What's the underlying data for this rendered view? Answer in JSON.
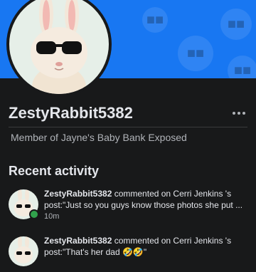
{
  "profile": {
    "username": "ZestyRabbit5382",
    "member_prefix": "Member of",
    "group_name": "Jayne's Baby Bank Exposed"
  },
  "recent_activity": {
    "title": "Recent activity",
    "items": [
      {
        "user": "ZestyRabbit5382",
        "action": "commented on Cerri Jenkins 's",
        "post_text": "post:\"Just so you guys know those photos she put ...",
        "time": "10m"
      },
      {
        "user": "ZestyRabbit5382",
        "action": "commented on Cerri Jenkins 's",
        "post_text": "post:\"That's her dad 🤣🤣\"",
        "time": ""
      }
    ]
  },
  "colors": {
    "cover": "#1877f2",
    "background": "#18191a",
    "online": "#31a24c"
  },
  "icons": {
    "more": "more-horizontal-icon",
    "online": "online-status-icon"
  }
}
